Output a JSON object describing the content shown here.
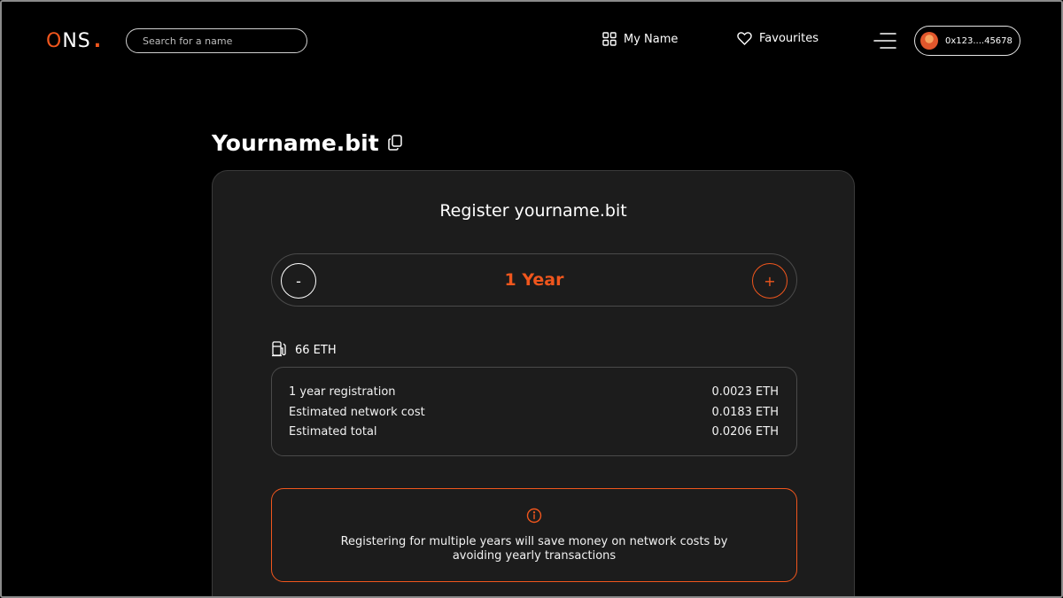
{
  "nav": {
    "logo": {
      "o": "O",
      "ns": "NS",
      "dot": "."
    },
    "search": {
      "placeholder": "Search for a name",
      "value": ""
    },
    "my_name": "My Name",
    "favourites": "Favourites",
    "wallet_address": "0x123....45678"
  },
  "page": {
    "title": "Yourname.bit"
  },
  "register": {
    "title": "Register yourname.bit",
    "minus_label": "-",
    "plus_label": "+",
    "duration": "1 Year",
    "gas": "66 ETH",
    "costs": [
      {
        "label": "1 year registration",
        "value": "0.0023 ETH"
      },
      {
        "label": "Estimated network cost",
        "value": "0.0183 ETH"
      },
      {
        "label": "Estimated total",
        "value": "0.0206 ETH"
      }
    ],
    "info": "Registering for multiple years will save money on network costs by avoiding yearly transactions"
  },
  "colors": {
    "accent": "#f0561d",
    "background": "#000000",
    "card": "#1c1c1c"
  },
  "icons": [
    "grid-icon",
    "heart-icon",
    "hamburger-menu-icon",
    "copy-icon",
    "gas-pump-icon",
    "info-icon"
  ]
}
